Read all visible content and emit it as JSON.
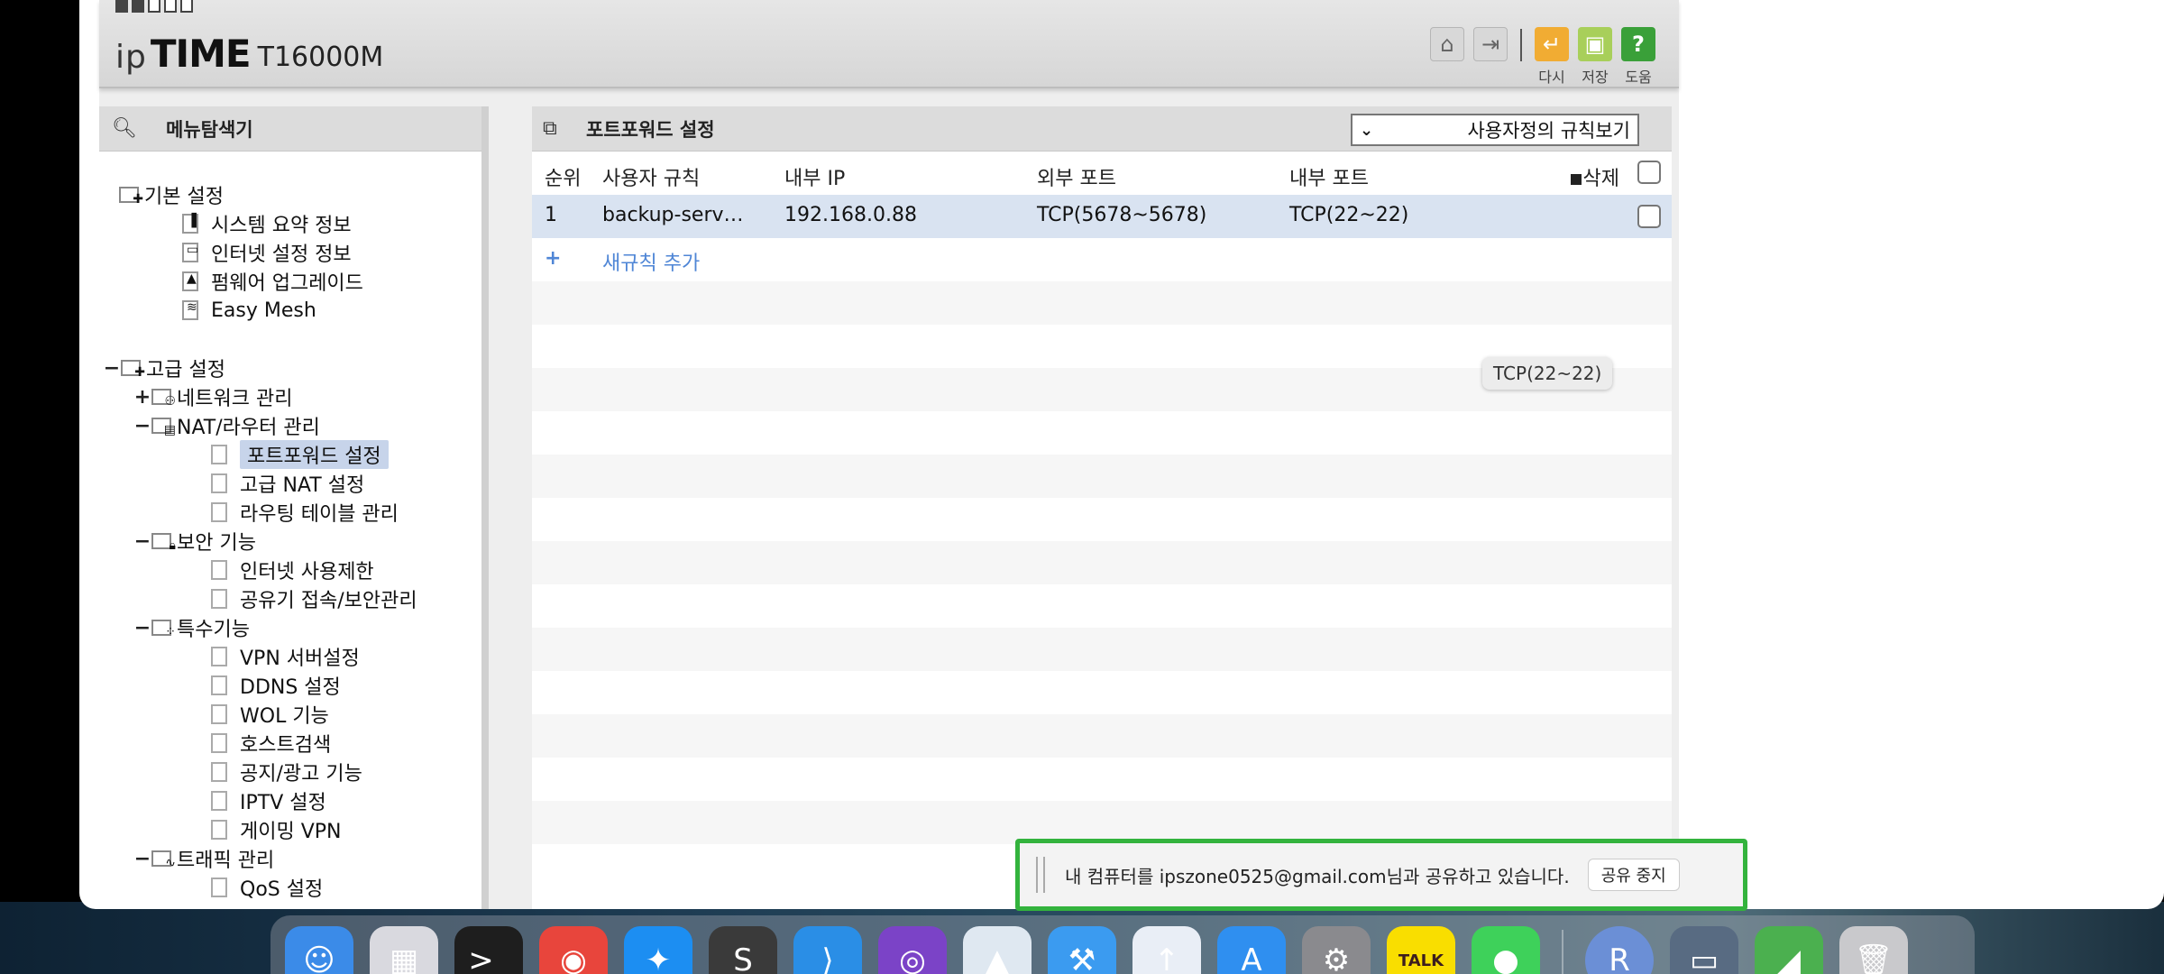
{
  "router": {
    "brand_ip": "ip",
    "brand_time": "TIME",
    "model": "T16000M"
  },
  "toolbar": {
    "home_icon": "home-icon",
    "logout_icon": "logout-icon",
    "reload_label": "다시",
    "save_label": "저장",
    "help_label": "도움"
  },
  "menu": {
    "title": "메뉴탐색기",
    "sections": [
      {
        "label": "기본 설정",
        "toggle": ""
      },
      {
        "label": "시스템 요약 정보"
      },
      {
        "label": "인터넷 설정 정보"
      },
      {
        "label": "펌웨어 업그레이드"
      },
      {
        "label": "Easy Mesh"
      },
      {
        "label": "고급 설정",
        "toggle": "−"
      },
      {
        "label": "네트워크 관리",
        "toggle": "+"
      },
      {
        "label": "NAT/라우터 관리",
        "toggle": "−"
      },
      {
        "label": "포트포워드 설정"
      },
      {
        "label": "고급 NAT 설정"
      },
      {
        "label": "라우팅 테이블 관리"
      },
      {
        "label": "보안 기능",
        "toggle": "−"
      },
      {
        "label": "인터넷 사용제한"
      },
      {
        "label": "공유기 접속/보안관리"
      },
      {
        "label": "특수기능",
        "toggle": "−"
      },
      {
        "label": "VPN 서버설정"
      },
      {
        "label": "DDNS 설정"
      },
      {
        "label": "WOL 기능"
      },
      {
        "label": "호스트검색"
      },
      {
        "label": "공지/광고 기능"
      },
      {
        "label": "IPTV 설정"
      },
      {
        "label": "게이밍 VPN"
      },
      {
        "label": "트래픽 관리",
        "toggle": "−"
      },
      {
        "label": "QoS 설정"
      }
    ]
  },
  "portforward": {
    "title": "포트포워드 설정",
    "view_select": "사용자정의 규칙보기",
    "columns": {
      "rank": "순위",
      "rule": "사용자 규칙",
      "internal_ip": "내부 IP",
      "external_port": "외부 포트",
      "internal_port": "내부 포트",
      "delete": "삭제"
    },
    "rows": [
      {
        "rank": "1",
        "rule": "backup-serv…",
        "internal_ip": "192.168.0.88",
        "external_port": "TCP(5678~5678)",
        "internal_port": "TCP(22~22)"
      }
    ],
    "add_rule_plus": "+",
    "add_rule_label": "새규칙 추가",
    "tooltip": "TCP(22~22)"
  },
  "share_banner": {
    "message": "내 컴퓨터를 ipszone0525@gmail.com님과 공유하고 있습니다.",
    "stop_label": "공유 중지"
  },
  "dock": {
    "apps": [
      {
        "name": "finder-icon",
        "color": "#3b8be8",
        "glyph": "☺"
      },
      {
        "name": "launchpad-icon",
        "color": "#d9d9df",
        "glyph": "▦"
      },
      {
        "name": "terminal-icon",
        "color": "#1e1e1e",
        "glyph": ">_"
      },
      {
        "name": "chrome-icon",
        "color": "#e8453c",
        "glyph": "◉"
      },
      {
        "name": "safari-icon",
        "color": "#1c8ef2",
        "glyph": "✦"
      },
      {
        "name": "sublime-icon",
        "color": "#3a3a3a",
        "glyph": "S"
      },
      {
        "name": "vscode-icon",
        "color": "#2a8ee6",
        "glyph": "⟩"
      },
      {
        "name": "github-desktop-icon",
        "color": "#7b43c7",
        "glyph": "◎"
      },
      {
        "name": "preview-icon",
        "color": "#dfe8f1",
        "glyph": "▲"
      },
      {
        "name": "xcode-icon",
        "color": "#3b9bf0",
        "glyph": "⚒"
      },
      {
        "name": "transporter-icon",
        "color": "#e9eef6",
        "glyph": "↑"
      },
      {
        "name": "app-store-icon",
        "color": "#2f8ff0",
        "glyph": "A"
      },
      {
        "name": "system-settings-icon",
        "color": "#8a8a8e",
        "glyph": "⚙"
      },
      {
        "name": "kakaotalk-icon",
        "color": "#f9de00",
        "glyph": "TALK"
      },
      {
        "name": "messages-icon",
        "color": "#3ed15a",
        "glyph": "●"
      },
      {
        "name": "user-r-icon",
        "color": "#6b8fd6",
        "glyph": "R"
      },
      {
        "name": "screen-sharing-icon",
        "color": "#586b82",
        "glyph": "▭"
      },
      {
        "name": "android-studio-icon",
        "color": "#4bb04f",
        "glyph": "◢"
      },
      {
        "name": "trash-icon",
        "color": "#c9c9cc",
        "glyph": "🗑"
      }
    ]
  }
}
